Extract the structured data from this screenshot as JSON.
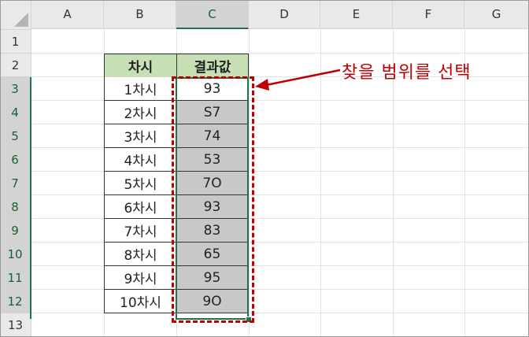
{
  "columns": [
    "A",
    "B",
    "C",
    "D",
    "E",
    "F",
    "G"
  ],
  "rows": [
    "1",
    "2",
    "3",
    "4",
    "5",
    "6",
    "7",
    "8",
    "9",
    "10",
    "11",
    "12",
    "13"
  ],
  "table": {
    "header": {
      "b": "차시",
      "c": "결과값"
    },
    "rows": [
      {
        "b": "1차시",
        "c": "93"
      },
      {
        "b": "2차시",
        "c": "S7"
      },
      {
        "b": "3차시",
        "c": "74"
      },
      {
        "b": "4차시",
        "c": "53"
      },
      {
        "b": "5차시",
        "c": "7O"
      },
      {
        "b": "6차시",
        "c": "93"
      },
      {
        "b": "7차시",
        "c": "83"
      },
      {
        "b": "8차시",
        "c": "65"
      },
      {
        "b": "9차시",
        "c": "95"
      },
      {
        "b": "10차시",
        "c": "9O"
      }
    ]
  },
  "annotation": {
    "text": "찾을 범위를 선택",
    "color": "#c00000"
  },
  "colors": {
    "selection_green": "#217346",
    "header_fill": "#c6dfb4",
    "selected_fill": "#c8c8c8"
  }
}
